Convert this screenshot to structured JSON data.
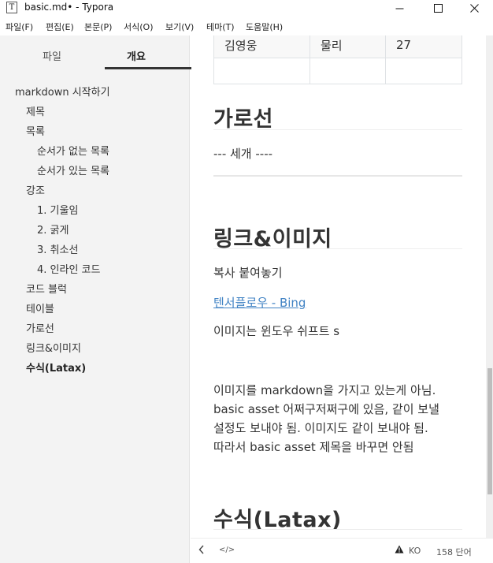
{
  "window": {
    "title": "basic.md• - Typora",
    "icon_letter": "T",
    "controls": [
      "minimize-icon",
      "maximize-icon",
      "close-icon"
    ]
  },
  "menu": [
    "파일(F)",
    "편집(E)",
    "본문(P)",
    "서식(O)",
    "보기(V)",
    "테마(T)",
    "도움말(H)"
  ],
  "sidebar": {
    "tabs": [
      {
        "label": "파일",
        "active": false
      },
      {
        "label": "개요",
        "active": true
      }
    ],
    "toc": [
      {
        "label": "markdown 시작하기",
        "level": 1
      },
      {
        "label": "제목",
        "level": 2
      },
      {
        "label": "목록",
        "level": 2
      },
      {
        "label": "순서가 없는 목록",
        "level": 3
      },
      {
        "label": "순서가 있는 목록",
        "level": 3
      },
      {
        "label": "강조",
        "level": 2
      },
      {
        "label": "1. 기울임",
        "level": 3
      },
      {
        "label": "2. 굵게",
        "level": 3
      },
      {
        "label": "3. 취소선",
        "level": 3
      },
      {
        "label": "4. 인라인 코드",
        "level": 3
      },
      {
        "label": "코드 블럭",
        "level": 2
      },
      {
        "label": "테이블",
        "level": 2
      },
      {
        "label": "가로선",
        "level": 2
      },
      {
        "label": "링크&이미지",
        "level": 2
      },
      {
        "label": "수식(Latax)",
        "level": 2,
        "active": true
      }
    ]
  },
  "content": {
    "table_rows": [
      [
        "김영웅",
        "물리",
        "27"
      ],
      [
        "",
        "",
        ""
      ]
    ],
    "heading_hr": "가로선",
    "hr_text": "--- 세개 ----",
    "heading_link": "링크&이미지",
    "copy_text": "복사 붙여놓기",
    "link_text": "텐서플로우 - Bing",
    "image_text": "이미지는 윈도우 쉬프트 s",
    "paragraph_lines": [
      "이미지를 markdown을 가지고 있는게 아님.",
      "basic asset 어쩌구저쩌구에 있음,  같이 보낼",
      "설정도 보내야 됨. 이미지도 같이 보내야 됨.",
      "따라서 basic asset 제목을 바꾸면 안됨"
    ],
    "heading_math": "수식(Latax)"
  },
  "footer": {
    "back_icon": "chevron-left-icon",
    "source_icon": "</>",
    "warn_icon": "warning-icon",
    "lang": "KO",
    "word_count": "158 단어"
  },
  "colors": {
    "link": "#4183c4",
    "sidebar_bg": "#f3f3f3",
    "text": "#333333"
  }
}
